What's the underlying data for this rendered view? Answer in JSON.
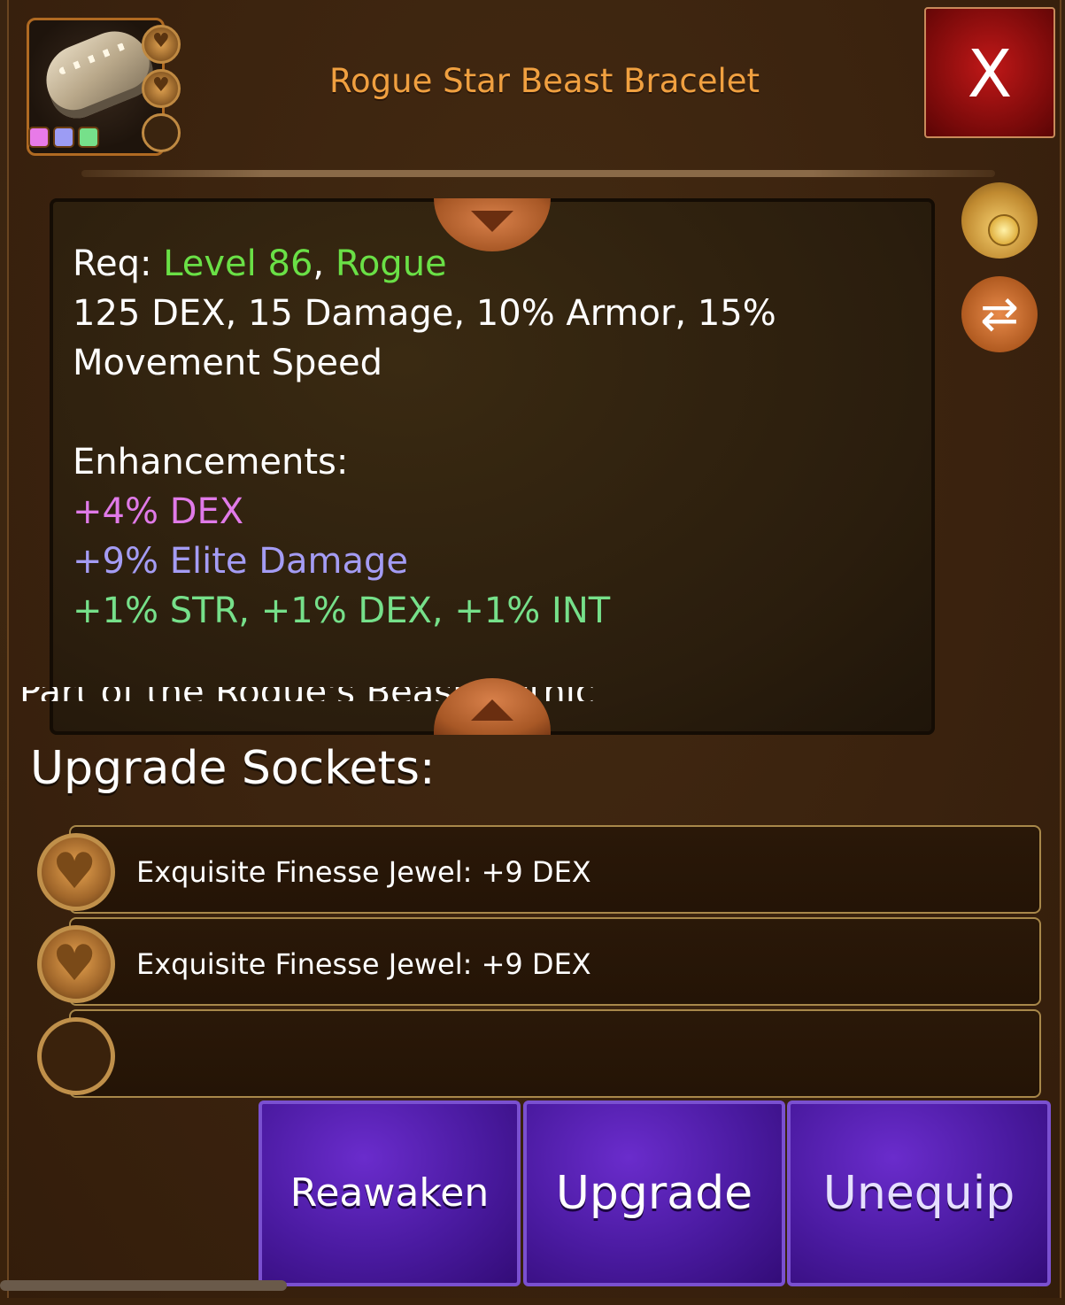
{
  "header": {
    "title": "Rogue Star Beast Bracelet",
    "close_label": "X",
    "gem_colors": [
      "#e87ae8",
      "#9c9cf4",
      "#76e08a"
    ]
  },
  "description": {
    "req_label": "Req: ",
    "req_level": "Level 86",
    "req_sep": ", ",
    "req_class": "Rogue",
    "stats_line1": "125 DEX, 15 Damage, 10% Armor, 15%",
    "stats_line2": "Movement Speed",
    "enhancements_label": "Enhancements:",
    "enh_1": "+4% DEX",
    "enh_2": "+9% Elite Damage",
    "enh_3": "+1% STR, +1% DEX, +1% INT",
    "cut_line": "Part of the Rogue's Beast Mythic"
  },
  "sockets": {
    "title": "Upgrade Sockets:",
    "items": [
      {
        "label": "Exquisite Finesse Jewel: +9 DEX"
      },
      {
        "label": "Exquisite Finesse Jewel: +9 DEX"
      },
      {
        "label": ""
      }
    ]
  },
  "actions": {
    "reawaken": "Reawaken",
    "upgrade": "Upgrade",
    "unequip": "Unequip"
  }
}
